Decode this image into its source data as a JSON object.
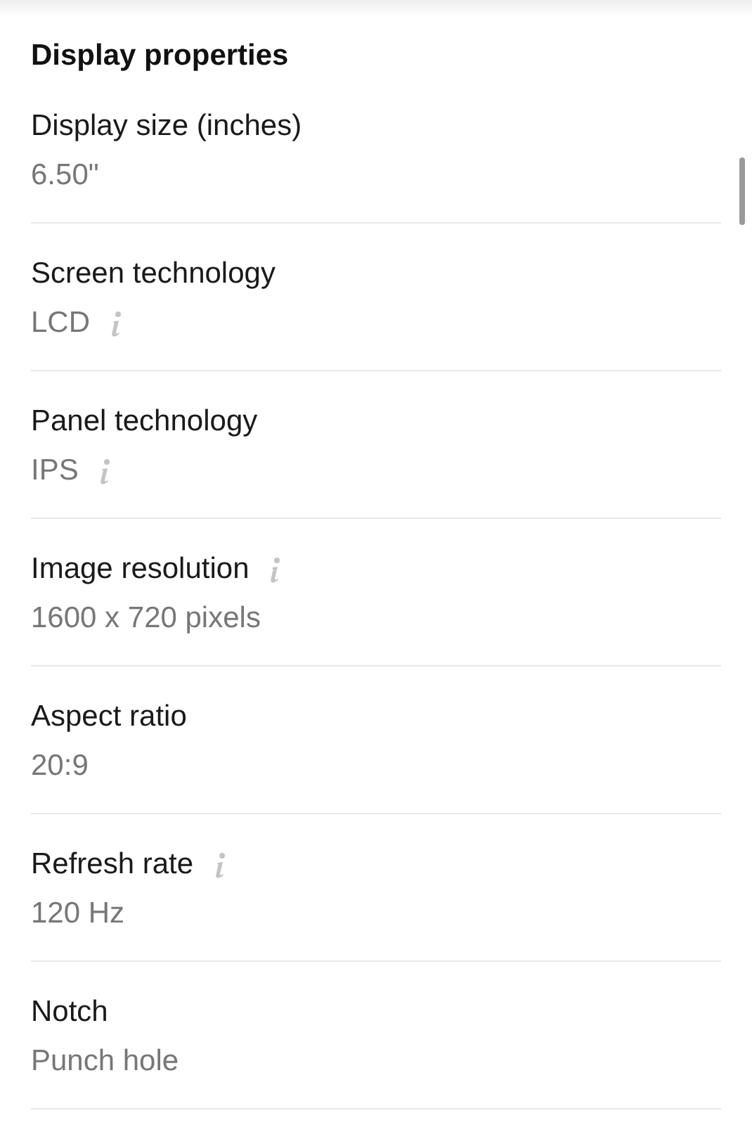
{
  "section": {
    "title": "Display properties"
  },
  "properties": [
    {
      "label": "Display size (inches)",
      "value": "6.50\"",
      "label_info": false,
      "value_info": false
    },
    {
      "label": "Screen technology",
      "value": "LCD",
      "label_info": false,
      "value_info": true
    },
    {
      "label": "Panel technology",
      "value": "IPS",
      "label_info": false,
      "value_info": true
    },
    {
      "label": "Image resolution",
      "value": "1600 x 720 pixels",
      "label_info": true,
      "value_info": false
    },
    {
      "label": "Aspect ratio",
      "value": "20:9",
      "label_info": false,
      "value_info": false
    },
    {
      "label": "Refresh rate",
      "value": "120 Hz",
      "label_info": true,
      "value_info": false
    },
    {
      "label": "Notch",
      "value": "Punch hole",
      "label_info": false,
      "value_info": false
    }
  ]
}
